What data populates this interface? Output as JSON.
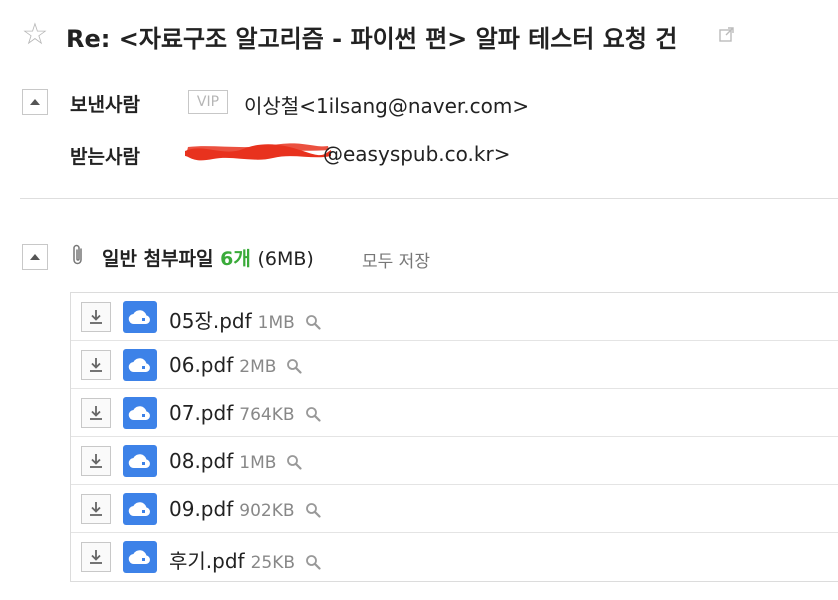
{
  "header": {
    "subject": "Re: <자료구조 알고리즘 - 파이썬 편> 알파 테스터 요청 건"
  },
  "sender": {
    "label": "보낸사람",
    "badge": "VIP",
    "address": "이상철<1ilsang@naver.com>"
  },
  "recipient": {
    "label": "받는사람",
    "address_visible": "@easyspub.co.kr>"
  },
  "attachments": {
    "title": "일반 첨부파일",
    "count": "6개",
    "total_size": "(6MB)",
    "save_all": "모두 저장",
    "files": [
      {
        "name": "05장.pdf",
        "size": "1MB"
      },
      {
        "name": "06.pdf",
        "size": "2MB"
      },
      {
        "name": "07.pdf",
        "size": "764KB"
      },
      {
        "name": "08.pdf",
        "size": "1MB"
      },
      {
        "name": "09.pdf",
        "size": "902KB"
      },
      {
        "name": "후기.pdf",
        "size": "25KB"
      }
    ]
  },
  "colors": {
    "accent_green": "#3aab3a",
    "cloud_blue": "#3d82e8",
    "redaction": "#e8321e"
  },
  "icons": [
    "star-icon",
    "popout-icon",
    "collapse-icon",
    "paperclip-icon",
    "download-icon",
    "cloud-icon",
    "magnifier-icon"
  ]
}
